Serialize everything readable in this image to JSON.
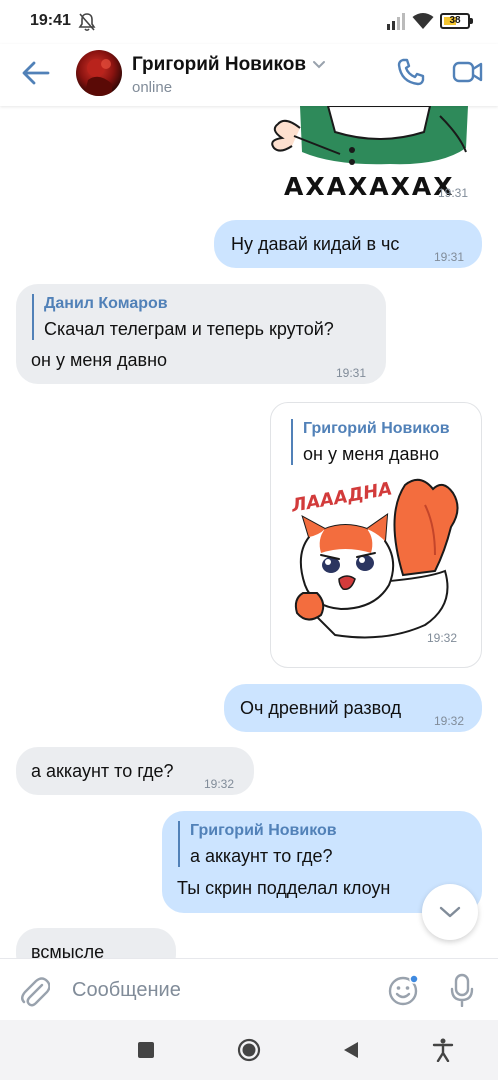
{
  "status_bar": {
    "time": "19:41",
    "battery": "38",
    "icons": [
      "bell-off-icon",
      "signal-icon",
      "wifi-icon",
      "battery-icon"
    ]
  },
  "header": {
    "back_icon": "arrow-left-icon",
    "name": "Григорий Новиков",
    "status": "online",
    "call_icon": "phone-icon",
    "video_icon": "video-camera-icon"
  },
  "messages": [
    {
      "type": "sticker",
      "direction": "incoming",
      "text": "АХАХАХАХ",
      "time": "19:31"
    },
    {
      "type": "text",
      "direction": "outgoing",
      "text": "Ну давай кидай в чс",
      "time": "19:31"
    },
    {
      "type": "text",
      "direction": "incoming",
      "reply": {
        "name": "Данил Комаров",
        "text": "Скачал телеграм и теперь крутой?"
      },
      "text": "он у меня давно",
      "time": "19:31"
    },
    {
      "type": "sticker",
      "direction": "outgoing",
      "reply": {
        "name": "Григорий Новиков",
        "text": "он у меня давно"
      },
      "text": "ЛАААДНА",
      "time": "19:32"
    },
    {
      "type": "text",
      "direction": "outgoing",
      "text": "Оч древний развод",
      "time": "19:32"
    },
    {
      "type": "text",
      "direction": "incoming",
      "text": "а аккаунт то где?",
      "time": "19:32"
    },
    {
      "type": "text",
      "direction": "outgoing",
      "reply": {
        "name": "Григорий Новиков",
        "text": "а аккаунт то где?"
      },
      "text": "Ты скрин подделал клоун",
      "time": ""
    },
    {
      "type": "text",
      "direction": "incoming",
      "text": "всмысле",
      "time": ""
    }
  ],
  "composer": {
    "placeholder": "Сообщение",
    "attach_icon": "paperclip-icon",
    "emoji_icon": "emoji-smile-icon",
    "mic_icon": "microphone-icon"
  },
  "nav_bar": {
    "icons": [
      "recents-square-icon",
      "home-circle-icon",
      "back-triangle-icon",
      "accessibility-icon"
    ]
  },
  "colors": {
    "accent": "#5181b8",
    "outgoing_bubble": "#cce4ff",
    "incoming_bubble": "#ebedf0",
    "secondary_text": "#818c99"
  }
}
